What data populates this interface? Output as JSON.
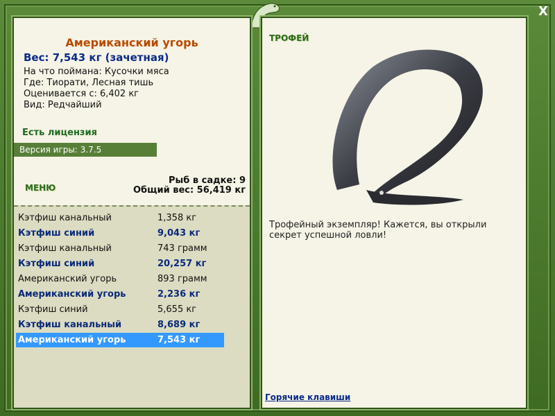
{
  "catch": {
    "title": "Американский угорь",
    "weight": "Вес: 7,543 кг (зачетная)",
    "bait": "На что поймана: Кусочки мяса",
    "place": "Где: Тиорати, Лесная тишь",
    "value": "Оценивается с: 6,402 кг",
    "rarity": "Вид: Редчайший"
  },
  "license": "Есть лицензия",
  "version": "Версия игры: 3.7.5",
  "menu": "МЕНЮ",
  "cage": {
    "count": "Рыб в садке: 9",
    "total": "Общий вес: 56,419 кг"
  },
  "fish_list": [
    {
      "name": "Кэтфиш канальный",
      "weight": "1,358 кг",
      "style": "normal"
    },
    {
      "name": "Кэтфиш синий",
      "weight": "9,043 кг",
      "style": "bold"
    },
    {
      "name": "Кэтфиш канальный",
      "weight": "743 грамм",
      "style": "normal"
    },
    {
      "name": "Кэтфиш синий",
      "weight": "20,257 кг",
      "style": "bold"
    },
    {
      "name": "Американский угорь",
      "weight": "893 грамм",
      "style": "normal"
    },
    {
      "name": "Американский угорь",
      "weight": "2,236 кг",
      "style": "bold"
    },
    {
      "name": "Кэтфиш синий",
      "weight": "5,655 кг",
      "style": "normal"
    },
    {
      "name": "Кэтфиш канальный",
      "weight": "8,689 кг",
      "style": "bold"
    },
    {
      "name": "Американский угорь",
      "weight": "7,543 кг",
      "style": "selected"
    }
  ],
  "trophy": {
    "label": "ТРОФЕЙ",
    "text": "Трофейный экземпляр! Кажется, вы открыли секрет успешной ловли!"
  },
  "hotkeys": "Горячие клавиши",
  "close": "X",
  "colors": {
    "frame": "#4a7a2c",
    "panel": "#f5f4e6",
    "selected": "#3399ff",
    "title": "#b94a00",
    "bold_row": "#0a2a7a"
  }
}
